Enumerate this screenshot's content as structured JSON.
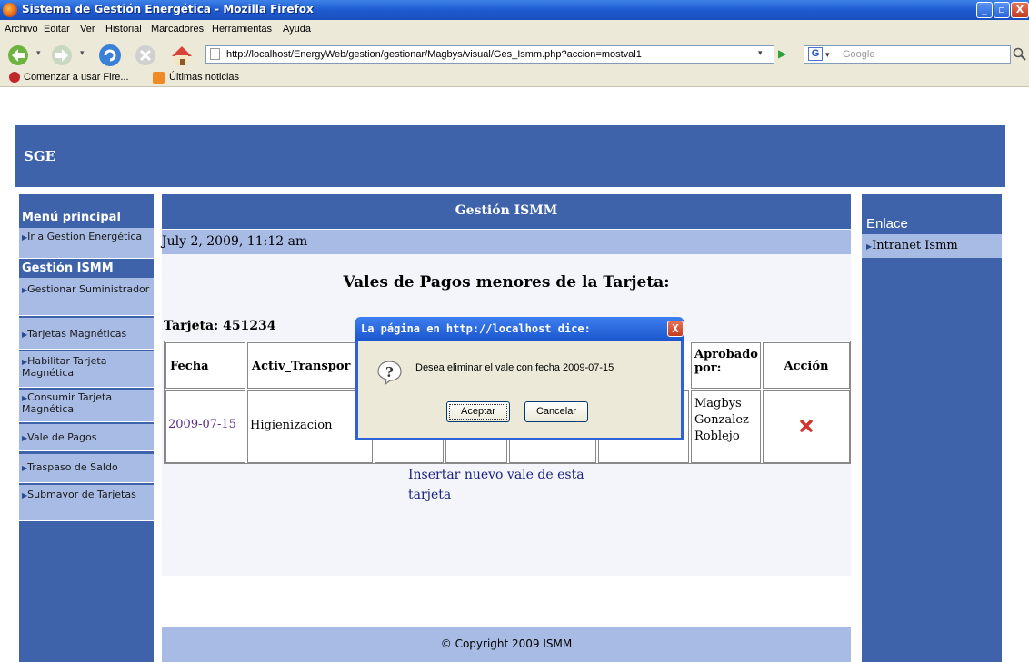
{
  "window": {
    "title": "Sistema de Gestión Energética - Mozilla Firefox"
  },
  "menubar": [
    "Archivo",
    "Editar",
    "Ver",
    "Historial",
    "Marcadores",
    "Herramientas",
    "Ayuda"
  ],
  "navbar": {
    "url": "http://localhost/EnergyWeb/gestion/gestionar/Magbys/visual/Ges_Ismm.php?accion=mostval1",
    "search_placeholder": "Google"
  },
  "bookmarks": [
    "Comenzar a usar Fire...",
    "Últimas noticias"
  ],
  "site": {
    "logo": "SGE"
  },
  "leftmenu": {
    "main_heading": "Menú principal",
    "link_gestion_energetica": "Ir a Gestion Energética",
    "section_heading": "Gestión ISMM",
    "items": [
      "Gestionar Suministrador",
      "Tarjetas Magnéticas",
      "Habilitar Tarjeta Magnética",
      "Consumir Tarjeta Magnética",
      "Vale de Pagos",
      "Traspaso de Saldo",
      "Submayor de Tarjetas"
    ]
  },
  "content": {
    "title": "Gestión ISMM",
    "date": "July 2, 2009, 11:12 am",
    "heading": "Vales de Pagos menores de la Tarjeta:",
    "tarjeta": "Tarjeta: 451234",
    "table": {
      "headers": [
        "Fecha",
        "Activ_Transpor",
        "Aprobado por:",
        "Acción"
      ],
      "row": {
        "fecha": "2009-07-15",
        "actividad": "Higienizacion",
        "aprobado": "Magbys Gonzalez Roblejo"
      }
    },
    "new_link": "Insertar nuevo vale de esta tarjeta"
  },
  "right": {
    "heading": "Enlace",
    "item": "Intranet Ismm"
  },
  "footer": "© Copyright 2009 ISMM",
  "dialog": {
    "title": "La página en http://localhost dice:",
    "message": "Desea eliminar el vale con fecha  2009-07-15",
    "ok": "Aceptar",
    "cancel": "Cancelar"
  }
}
